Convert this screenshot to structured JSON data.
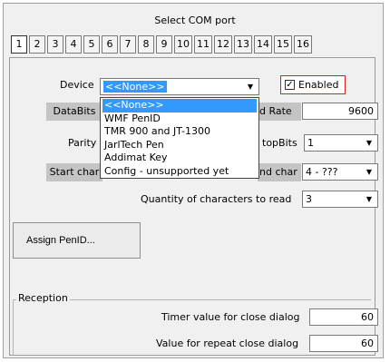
{
  "title": "Select COM port",
  "tabs": [
    "1",
    "2",
    "3",
    "4",
    "5",
    "6",
    "7",
    "8",
    "9",
    "10",
    "11",
    "12",
    "13",
    "14",
    "15",
    "16"
  ],
  "active_tab": "1",
  "device": {
    "label": "Device",
    "selected": "<<None>>",
    "options": [
      "<<None>>",
      "WMF PenID",
      "TMR 900 and JT-1300",
      "JarlTech Pen",
      "Addimat Key",
      "Config - unsupported yet"
    ]
  },
  "enabled": {
    "label": "Enabled",
    "checked": true
  },
  "databits": {
    "label": "DataBits"
  },
  "baud": {
    "label": "d Rate",
    "value": "9600"
  },
  "parity": {
    "label": "Parity"
  },
  "stopbits": {
    "label": "topBits",
    "value": "1"
  },
  "start_char": {
    "label": "Start char"
  },
  "end_char": {
    "label": "nd char",
    "value": "4  - ???"
  },
  "quantity": {
    "label": "Quantity of characters to read",
    "value": "3"
  },
  "assign_button": {
    "label": "Assign PenID..."
  },
  "reception": {
    "title": "Reception",
    "timer_label": "Timer value for close dialog",
    "timer_value": "60",
    "repeat_label": "Value for repeat close dialog",
    "repeat_value": "60"
  },
  "icons": {
    "dropdown_arrow": "chevron-down-icon",
    "check": "checkmark-icon"
  }
}
